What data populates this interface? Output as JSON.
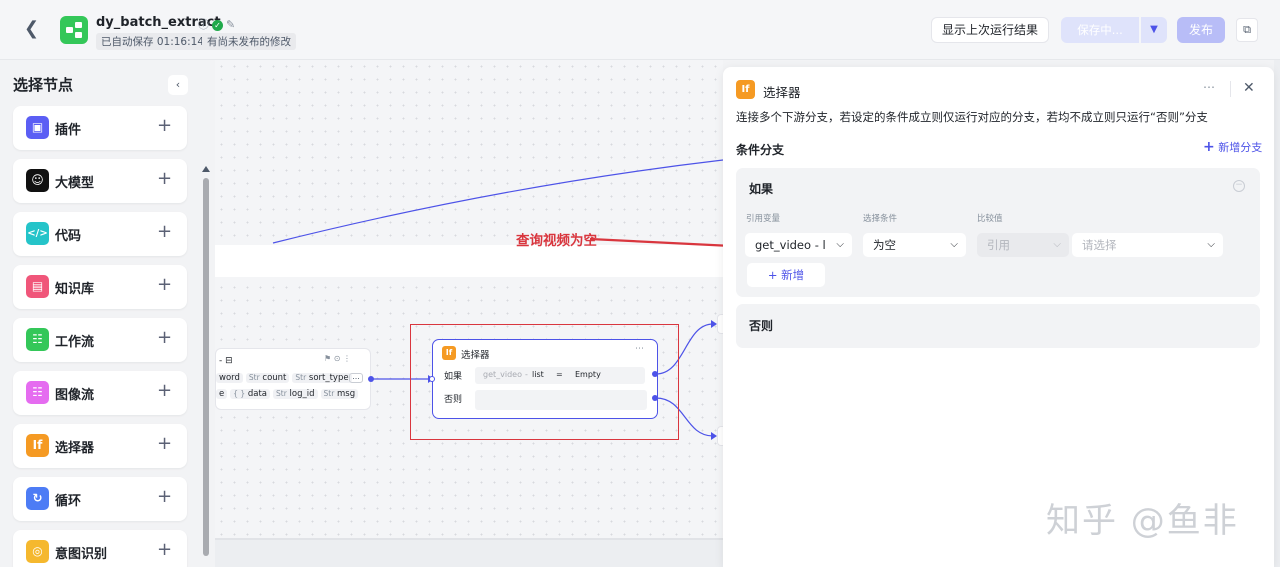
{
  "header": {
    "back_icon": "chevron-left-icon",
    "app_icon": "workflow-icon",
    "title": "dy_batch_extract",
    "autosave": "已自动保存 01:16:14",
    "unpublished": "有尚未发布的修改",
    "btn_last_run": "显示上次运行结果",
    "btn_save": "保存中...",
    "btn_publish": "发布",
    "accent": "#4d53e8"
  },
  "sidebar": {
    "title": "选择节点",
    "items": [
      {
        "label": "插件",
        "icon": "plugin-icon",
        "color": "#5b5ef4"
      },
      {
        "label": "大模型",
        "icon": "llm-icon",
        "color": "#111111"
      },
      {
        "label": "代码",
        "icon": "code-icon",
        "color": "#25c4c9"
      },
      {
        "label": "知识库",
        "icon": "knowledge-icon",
        "color": "#f0567a"
      },
      {
        "label": "工作流",
        "icon": "workflow-icon",
        "color": "#34c759"
      },
      {
        "label": "图像流",
        "icon": "imageflow-icon",
        "color": "#e56cf0"
      },
      {
        "label": "选择器",
        "icon": "selector-icon",
        "color": "#f59a23"
      },
      {
        "label": "循环",
        "icon": "loop-icon",
        "color": "#4d7cf5"
      },
      {
        "label": "意图识别",
        "icon": "intent-icon",
        "color": "#f5b82e"
      }
    ]
  },
  "canvas": {
    "annotation": "查询视频为空",
    "prev_node": {
      "row1": [
        "word",
        "count",
        "sort_type"
      ],
      "row1_types": [
        "",
        "Str",
        "Str"
      ],
      "row2": [
        "e",
        "data",
        "log_id",
        "msg"
      ],
      "row2_types": [
        "",
        "{ }",
        "Str",
        "Str"
      ]
    },
    "selector_node": {
      "title": "选择器",
      "if_label": "如果",
      "else_label": "否则",
      "cond_var": "get_video",
      "cond_sub": "list",
      "cond_op": "=",
      "cond_val": "Empty"
    }
  },
  "panel": {
    "title": "选择器",
    "description": "连接多个下游分支，若设定的条件成立则仅运行对应的分支，若均不成立则只运行“否则”分支",
    "section": "条件分支",
    "add_branch": "新增分支",
    "if_card": {
      "title": "如果",
      "col_var": "引用变量",
      "col_cond": "选择条件",
      "col_val": "比较值",
      "var_value": "get_video - l",
      "cond_value": "为空",
      "ref_value": "引用",
      "compare_placeholder": "请选择",
      "add_label": "新增"
    },
    "else_card": {
      "title": "否则"
    }
  },
  "watermark": "知乎 @鱼非"
}
